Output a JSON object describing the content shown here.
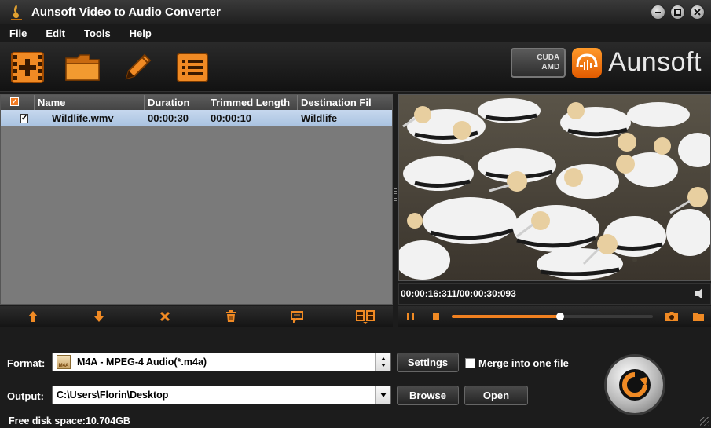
{
  "window": {
    "title": "Aunsoft Video to Audio Converter"
  },
  "menu": [
    "File",
    "Edit",
    "Tools",
    "Help"
  ],
  "toolbar": {
    "buttons": [
      {
        "name": "add-video-button",
        "icon": "film-plus-icon"
      },
      {
        "name": "add-folder-button",
        "icon": "folder-icon"
      },
      {
        "name": "edit-button",
        "icon": "pencil-icon"
      },
      {
        "name": "task-list-button",
        "icon": "list-icon"
      }
    ]
  },
  "brand": {
    "cuda_line1": "CUDA",
    "cuda_line2": "AMD",
    "name": "Aunsoft",
    "accent": "#f07a22"
  },
  "file_list": {
    "columns": [
      "Name",
      "Duration",
      "Trimmed Length",
      "Destination Fil"
    ],
    "rows": [
      {
        "checked": true,
        "name": "Wildlife.wmv",
        "duration": "00:00:30",
        "trimmed": "00:00:10",
        "destination": "Wildlife"
      }
    ]
  },
  "preview": {
    "time": "00:00:16:311/00:00:30:093",
    "progress": 0.54
  },
  "bottom": {
    "format_label": "Format:",
    "format_value": "M4A - MPEG-4 Audio(*.m4a)",
    "format_icon_text": "M4A",
    "settings_button": "Settings",
    "merge_label": "Merge into one file",
    "merge_checked": false,
    "output_label": "Output:",
    "output_value": "C:\\Users\\Florin\\Desktop",
    "browse_button": "Browse",
    "open_button": "Open",
    "free_space": "Free disk space:10.704GB"
  }
}
